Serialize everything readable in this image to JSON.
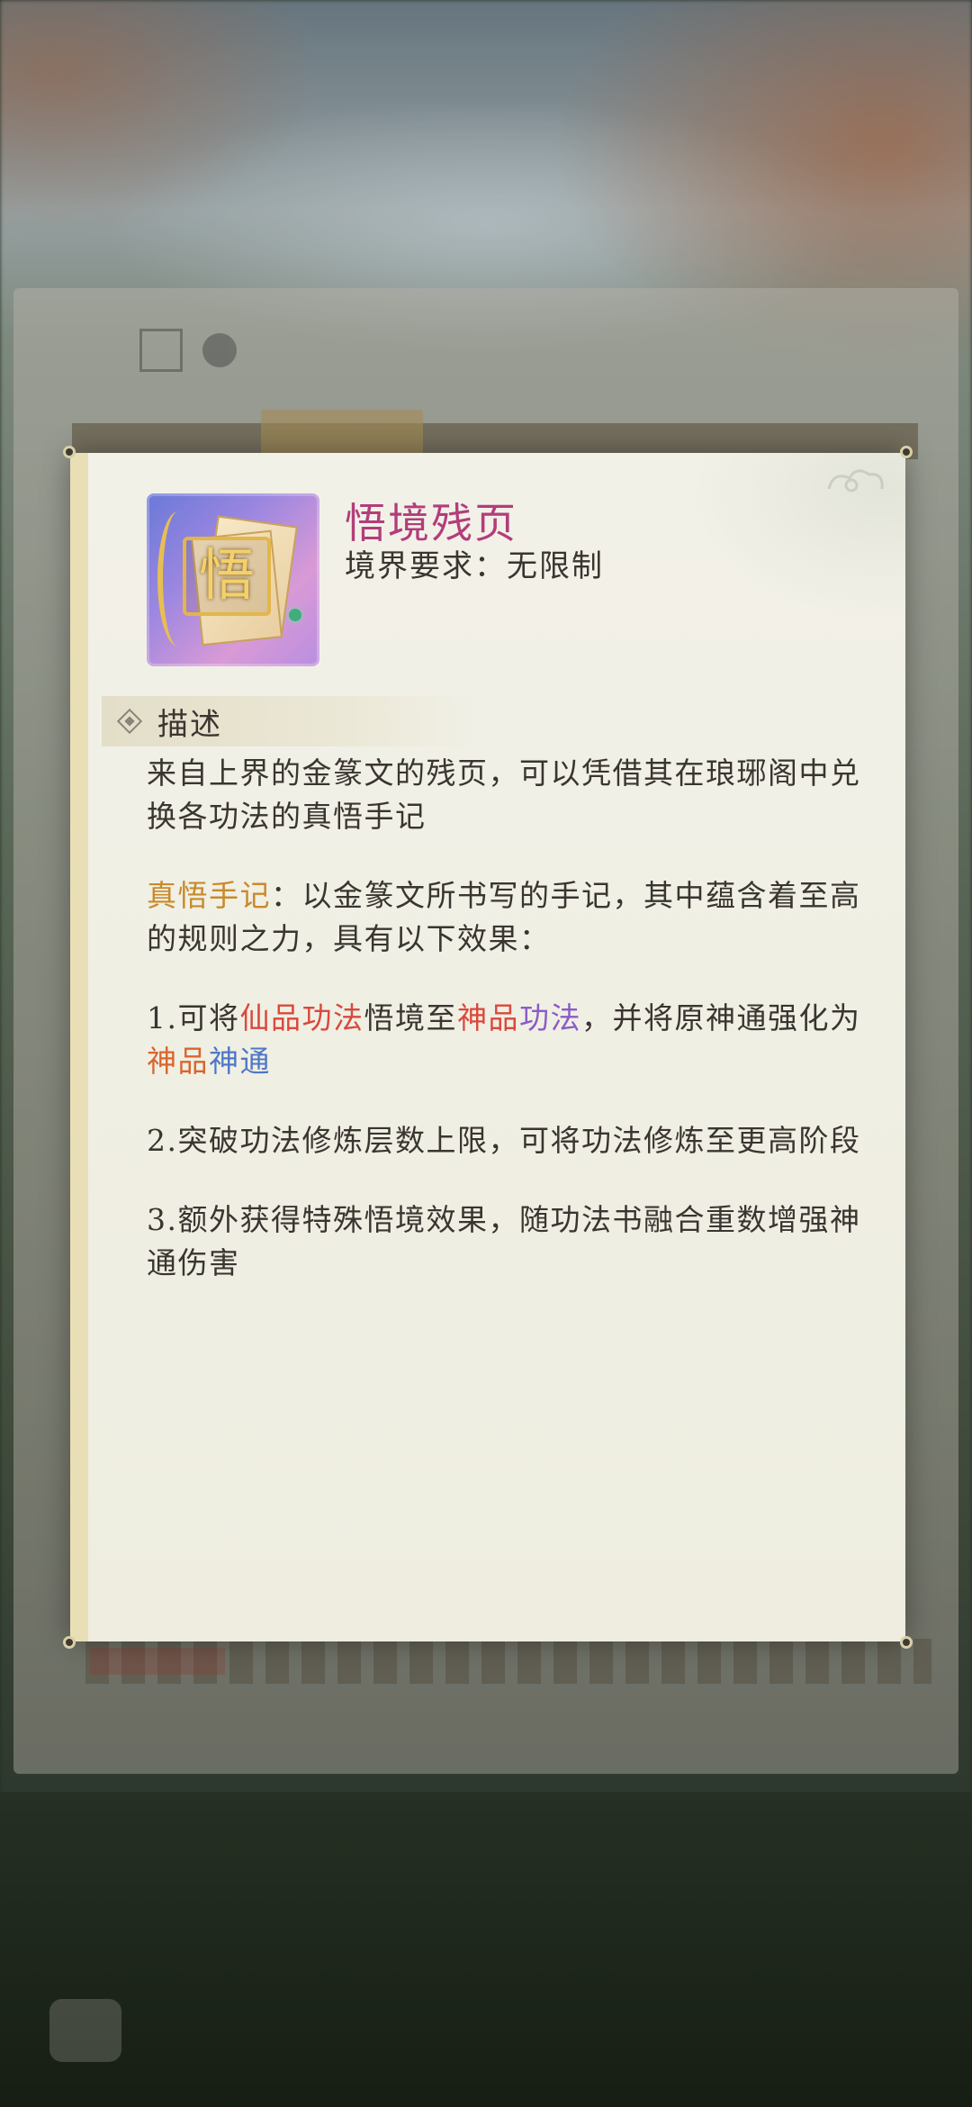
{
  "item": {
    "name": "悟境残页",
    "requirement": "境界要求：无限制",
    "icon": "wujing-page-icon",
    "icon_glyph": "悟"
  },
  "section": {
    "title": "描述"
  },
  "description": {
    "intro": "来自上界的金篆文的残页，可以凭借其在琅琊阁中兑换各功法的真悟手记",
    "note_term": "真悟手记",
    "note_text": "：以金篆文所书写的手记，其中蕴含着至高的规则之力，具有以下效果：",
    "effect1": {
      "prefix": "1.可将",
      "term1": "仙品功法",
      "mid": "悟境至",
      "term2a": "神品",
      "term2b": "功法",
      "mid2": "，并将原神通强化为",
      "term3a": "神品",
      "term3b": "神通"
    },
    "effect2": "2.突破功法修炼层数上限，可将功法修炼至更高阶段",
    "effect3": "3.额外获得特殊悟境效果，随功法书融合重数增强神通伤害"
  },
  "colors": {
    "item_name": "#b33d7a",
    "term_gold": "#c98a2c",
    "term_red": "#d9493d",
    "term_orange": "#d9662c",
    "term_purple": "#8a5cc6",
    "term_blue": "#4f77c6"
  }
}
